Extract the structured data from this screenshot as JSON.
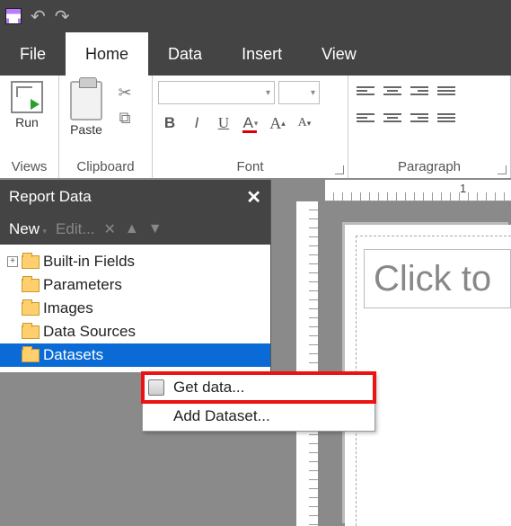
{
  "qat": {
    "undo_glyph": "↶",
    "redo_glyph": "↷"
  },
  "tabs": {
    "file": "File",
    "home": "Home",
    "data": "Data",
    "insert": "Insert",
    "view": "View"
  },
  "ribbon": {
    "views": {
      "run": "Run",
      "label": "Views"
    },
    "clipboard": {
      "paste": "Paste",
      "label": "Clipboard"
    },
    "font": {
      "label": "Font",
      "bold": "B",
      "italic": "I",
      "underline": "U",
      "fontcolor": "A",
      "sizeup": "A",
      "sizedown": "A"
    },
    "paragraph": {
      "label": "Paragraph"
    }
  },
  "panel": {
    "title": "Report Data",
    "new": "New",
    "edit": "Edit...",
    "tree": {
      "builtin": "Built-in Fields",
      "parameters": "Parameters",
      "images": "Images",
      "datasources": "Data Sources",
      "datasets": "Datasets"
    }
  },
  "ruler": {
    "mark1": "1"
  },
  "canvas": {
    "title_placeholder": "Click to"
  },
  "context_menu": {
    "get_data": "Get data...",
    "add_dataset": "Add Dataset..."
  }
}
